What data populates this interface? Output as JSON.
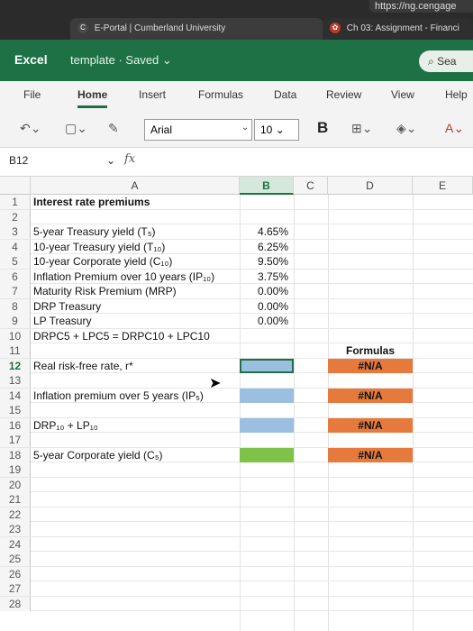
{
  "browser": {
    "address": "https://ng.cengage",
    "tab1_title": "E-Portal | Cumberland University",
    "tab2_title": "Ch 03: Assignment - Financi"
  },
  "app": {
    "name": "Excel",
    "doc_title": "template · Saved ⌄",
    "search_placeholder": "Sea"
  },
  "ribbon_tabs": [
    "File",
    "Home",
    "Insert",
    "Formulas",
    "Data",
    "Review",
    "View",
    "Help"
  ],
  "toolbar": {
    "font": "Arial",
    "size": "10",
    "bold": "B"
  },
  "formula_bar": {
    "name_box": "B12",
    "fx": "fx"
  },
  "columns": [
    "A",
    "B",
    "C",
    "D",
    "E"
  ],
  "rows": [
    {
      "n": "1",
      "a": "Interest rate premiums",
      "b": "",
      "d": ""
    },
    {
      "n": "2",
      "a": "",
      "b": "",
      "d": ""
    },
    {
      "n": "3",
      "a": "5-year Treasury yield (T₅)",
      "b": "4.65%",
      "d": ""
    },
    {
      "n": "4",
      "a": "10-year Treasury yield (T₁₀)",
      "b": "6.25%",
      "d": ""
    },
    {
      "n": "5",
      "a": "10-year Corporate yield (C₁₀)",
      "b": "9.50%",
      "d": ""
    },
    {
      "n": "6",
      "a": "Inflation Premium over 10 years (IP₁₀)",
      "b": "3.75%",
      "d": ""
    },
    {
      "n": "7",
      "a": "Maturity Risk Premium (MRP)",
      "b": "0.00%",
      "d": ""
    },
    {
      "n": "8",
      "a": "DRP Treasury",
      "b": "0.00%",
      "d": ""
    },
    {
      "n": "9",
      "a": "LP Treasury",
      "b": "0.00%",
      "d": ""
    },
    {
      "n": "10",
      "a": "DRPC5 + LPC5 = DRPC10 + LPC10",
      "b": "",
      "d": ""
    },
    {
      "n": "11",
      "a": "",
      "b": "",
      "d": "Formulas"
    },
    {
      "n": "12",
      "a": "Real risk-free rate, r*",
      "b": "",
      "d": "#N/A"
    },
    {
      "n": "13",
      "a": "",
      "b": "",
      "d": ""
    },
    {
      "n": "14",
      "a": "Inflation premium over 5 years (IP₅)",
      "b": "",
      "d": "#N/A"
    },
    {
      "n": "15",
      "a": "",
      "b": "",
      "d": ""
    },
    {
      "n": "16",
      "a": "DRP₁₀ + LP₁₀",
      "b": "",
      "d": "#N/A"
    },
    {
      "n": "17",
      "a": "",
      "b": "",
      "d": ""
    },
    {
      "n": "18",
      "a": "5-year Corporate yield (C₅)",
      "b": "",
      "d": "#N/A"
    },
    {
      "n": "19",
      "a": "",
      "b": "",
      "d": ""
    },
    {
      "n": "20",
      "a": "",
      "b": "",
      "d": ""
    },
    {
      "n": "21",
      "a": "",
      "b": "",
      "d": ""
    },
    {
      "n": "22",
      "a": "",
      "b": "",
      "d": ""
    },
    {
      "n": "23",
      "a": "",
      "b": "",
      "d": ""
    },
    {
      "n": "24",
      "a": "",
      "b": "",
      "d": ""
    },
    {
      "n": "25",
      "a": "",
      "b": "",
      "d": ""
    },
    {
      "n": "26",
      "a": "",
      "b": "",
      "d": ""
    },
    {
      "n": "27",
      "a": "",
      "b": "",
      "d": ""
    },
    {
      "n": "28",
      "a": "",
      "b": "",
      "d": ""
    }
  ],
  "colors": {
    "excel_green": "#1e7145",
    "input_blue": "#9bbfe0",
    "input_green": "#7ec24a",
    "formula_orange": "#e57a3c"
  }
}
